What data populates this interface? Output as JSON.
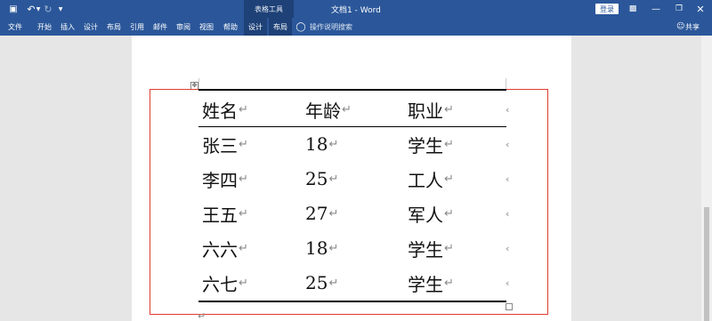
{
  "titlebar": {
    "context_group": "表格工具",
    "doc_title": "文档1 - Word",
    "login": "登录"
  },
  "menu": {
    "tabs": [
      "文件",
      "开始",
      "插入",
      "设计",
      "布局",
      "引用",
      "邮件",
      "审阅",
      "视图",
      "帮助",
      "设计",
      "布局"
    ],
    "tell_me": "操作说明搜索",
    "share": "共享"
  },
  "table": {
    "rows": [
      [
        "姓名",
        "年龄",
        "职业"
      ],
      [
        "张三",
        "18",
        "学生"
      ],
      [
        "李四",
        "25",
        "工人"
      ],
      [
        "王五",
        "27",
        "军人"
      ],
      [
        "六六",
        "18",
        "学生"
      ],
      [
        "六七",
        "25",
        "学生"
      ]
    ]
  },
  "icons": {
    "save": "save-icon",
    "undo": "undo-icon",
    "redo": "redo-icon",
    "lightbulb": "lightbulb-icon",
    "person": "person-icon"
  },
  "colors": {
    "accent": "#2b579a",
    "context": "#1e4177",
    "selection": "#e03c31"
  }
}
